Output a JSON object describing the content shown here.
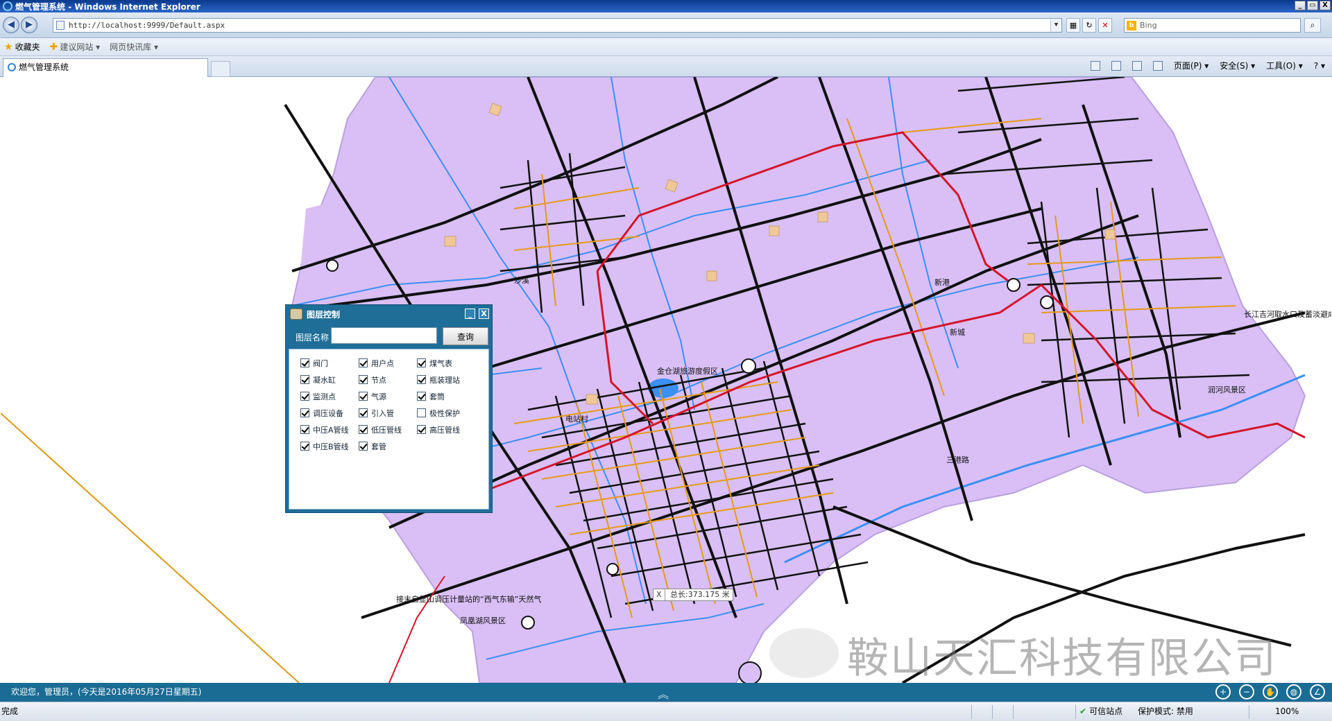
{
  "window": {
    "title": "燃气管理系统 - Windows Internet Explorer",
    "minimize": "_",
    "restore": "▭",
    "close": "X"
  },
  "address": {
    "url": "http://localhost:9999/Default.aspx",
    "search_placeholder": "Bing"
  },
  "favorites": {
    "label": "收藏夹",
    "suggested": "建议网站 ▾",
    "webslice": "网页快讯库 ▾"
  },
  "tab": {
    "title": "燃气管理系统"
  },
  "commandbar": {
    "page": "页面(P) ▾",
    "safety": "安全(S) ▾",
    "tools": "工具(O) ▾",
    "help": "? ▾"
  },
  "map_labels": {
    "l1": "长江吉河取水口及蓄淡避咸水库",
    "l2": "润河风景区",
    "l3": "凤凰湖风景区",
    "l4": "金仓湖旅游度假区",
    "l5": "接末自显山调压计量站的“西气东输”天然气",
    "l6": "新城",
    "l7": "沙溪",
    "l8": "新港",
    "l9": "电站村",
    "l10": "三港路"
  },
  "layer_panel": {
    "title": "图层控制",
    "minimize": "_",
    "close": "X",
    "name_label": "图层名称",
    "name_value": "",
    "query_button": "查询",
    "items": [
      {
        "label": "阀门",
        "checked": true
      },
      {
        "label": "用户点",
        "checked": true
      },
      {
        "label": "煤气表",
        "checked": true
      },
      {
        "label": "凝水缸",
        "checked": true
      },
      {
        "label": "节点",
        "checked": true
      },
      {
        "label": "瓶装理站",
        "checked": true
      },
      {
        "label": "监测点",
        "checked": true
      },
      {
        "label": "气源",
        "checked": true
      },
      {
        "label": "套筒",
        "checked": true
      },
      {
        "label": "调压设备",
        "checked": true
      },
      {
        "label": "引入管",
        "checked": true
      },
      {
        "label": "极性保护",
        "checked": false
      },
      {
        "label": "中压A管线",
        "checked": true
      },
      {
        "label": "低压管线",
        "checked": true
      },
      {
        "label": "高压管线",
        "checked": true
      },
      {
        "label": "中压B管线",
        "checked": true
      },
      {
        "label": "套管",
        "checked": true
      }
    ]
  },
  "measure": {
    "close": "X",
    "text": "总长:373.175 米"
  },
  "watermark": {
    "text": "鞍山天汇科技有限公司"
  },
  "app_status": {
    "welcome": "欢迎您，管理员，(今天是2016年05月27日星期五)",
    "collapse": "︽"
  },
  "ie_status": {
    "done": "完成",
    "trusted": "可信站点",
    "protected_mode": "保护模式: 禁用",
    "zoom": "100%"
  },
  "colors": {
    "district": "#d9bff5",
    "road": "#111111",
    "river": "#3b8ff5",
    "gas_low": "#e59a17",
    "gas_high": "#d4142b",
    "panel": "#1e6e98"
  }
}
